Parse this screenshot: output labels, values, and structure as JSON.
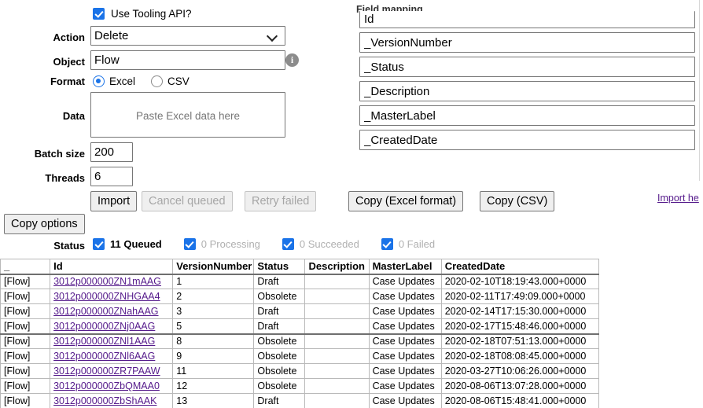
{
  "form": {
    "tooling_checkbox_label": "Use Tooling API?",
    "tooling_checked": true,
    "action_label": "Action",
    "action_value": "Delete",
    "action_options": [
      "Delete"
    ],
    "object_label": "Object",
    "object_value": "Flow",
    "info_icon": "info-icon",
    "format_label": "Format",
    "format_excel_label": "Excel",
    "format_csv_label": "CSV",
    "format_selected": "Excel",
    "data_label": "Data",
    "data_value": "",
    "data_placeholder": "Paste Excel data here",
    "batch_size_label": "Batch size",
    "batch_size_value": "200",
    "threads_label": "Threads",
    "threads_value": "6"
  },
  "buttons": {
    "import": "Import",
    "cancel_queued": "Cancel queued",
    "retry_failed": "Retry failed",
    "copy_excel": "Copy (Excel format)",
    "copy_csv": "Copy (CSV)",
    "copy_options": "Copy options",
    "help_link": "Import he"
  },
  "field_mapping": {
    "title": "Field mapping",
    "fields": [
      "Id",
      "_VersionNumber",
      "_Status",
      "_Description",
      "_MasterLabel",
      "_CreatedDate"
    ]
  },
  "status": {
    "label": "Status",
    "items": [
      {
        "text": "11 Queued",
        "checked": true,
        "active": true
      },
      {
        "text": "0 Processing",
        "checked": true,
        "active": false
      },
      {
        "text": "0 Succeeded",
        "checked": true,
        "active": false
      },
      {
        "text": "0 Failed",
        "checked": true,
        "active": false
      }
    ]
  },
  "results_table": {
    "columns": [
      "_",
      "Id",
      "VersionNumber",
      "Status",
      "Description",
      "MasterLabel",
      "CreatedDate"
    ],
    "rows": [
      {
        "flag": "[Flow]",
        "id": "3012p000000ZN1mAAG",
        "version": "1",
        "status": "Draft",
        "description": "",
        "master_label": "Case Updates",
        "created_date": "2020-02-10T18:19:43.000+0000"
      },
      {
        "flag": "[Flow]",
        "id": "3012p000000ZNHGAA4",
        "version": "2",
        "status": "Obsolete",
        "description": "",
        "master_label": "Case Updates",
        "created_date": "2020-02-11T17:49:09.000+0000"
      },
      {
        "flag": "[Flow]",
        "id": "3012p000000ZNahAAG",
        "version": "3",
        "status": "Draft",
        "description": "",
        "master_label": "Case Updates",
        "created_date": "2020-02-14T17:15:30.000+0000"
      },
      {
        "flag": "[Flow]",
        "id": "3012p000000ZNj0AAG",
        "version": "5",
        "status": "Draft",
        "description": "",
        "master_label": "Case Updates",
        "created_date": "2020-02-17T15:48:46.000+0000"
      },
      {
        "flag": "[Flow]",
        "id": "3012p000000ZNl1AAG",
        "version": "8",
        "status": "Obsolete",
        "description": "",
        "master_label": "Case Updates",
        "created_date": "2020-02-18T07:51:13.000+0000"
      },
      {
        "flag": "[Flow]",
        "id": "3012p000000ZNl6AAG",
        "version": "9",
        "status": "Obsolete",
        "description": "",
        "master_label": "Case Updates",
        "created_date": "2020-02-18T08:08:45.000+0000"
      },
      {
        "flag": "[Flow]",
        "id": "3012p000000ZR7PAAW",
        "version": "11",
        "status": "Obsolete",
        "description": "",
        "master_label": "Case Updates",
        "created_date": "2020-03-27T10:06:26.000+0000"
      },
      {
        "flag": "[Flow]",
        "id": "3012p000000ZbQMAA0",
        "version": "12",
        "status": "Obsolete",
        "description": "",
        "master_label": "Case Updates",
        "created_date": "2020-08-06T13:07:28.000+0000"
      },
      {
        "flag": "[Flow]",
        "id": "3012p000000ZbShAAK",
        "version": "13",
        "status": "Draft",
        "description": "",
        "master_label": "Case Updates",
        "created_date": "2020-08-06T15:48:41.000+0000"
      }
    ]
  }
}
